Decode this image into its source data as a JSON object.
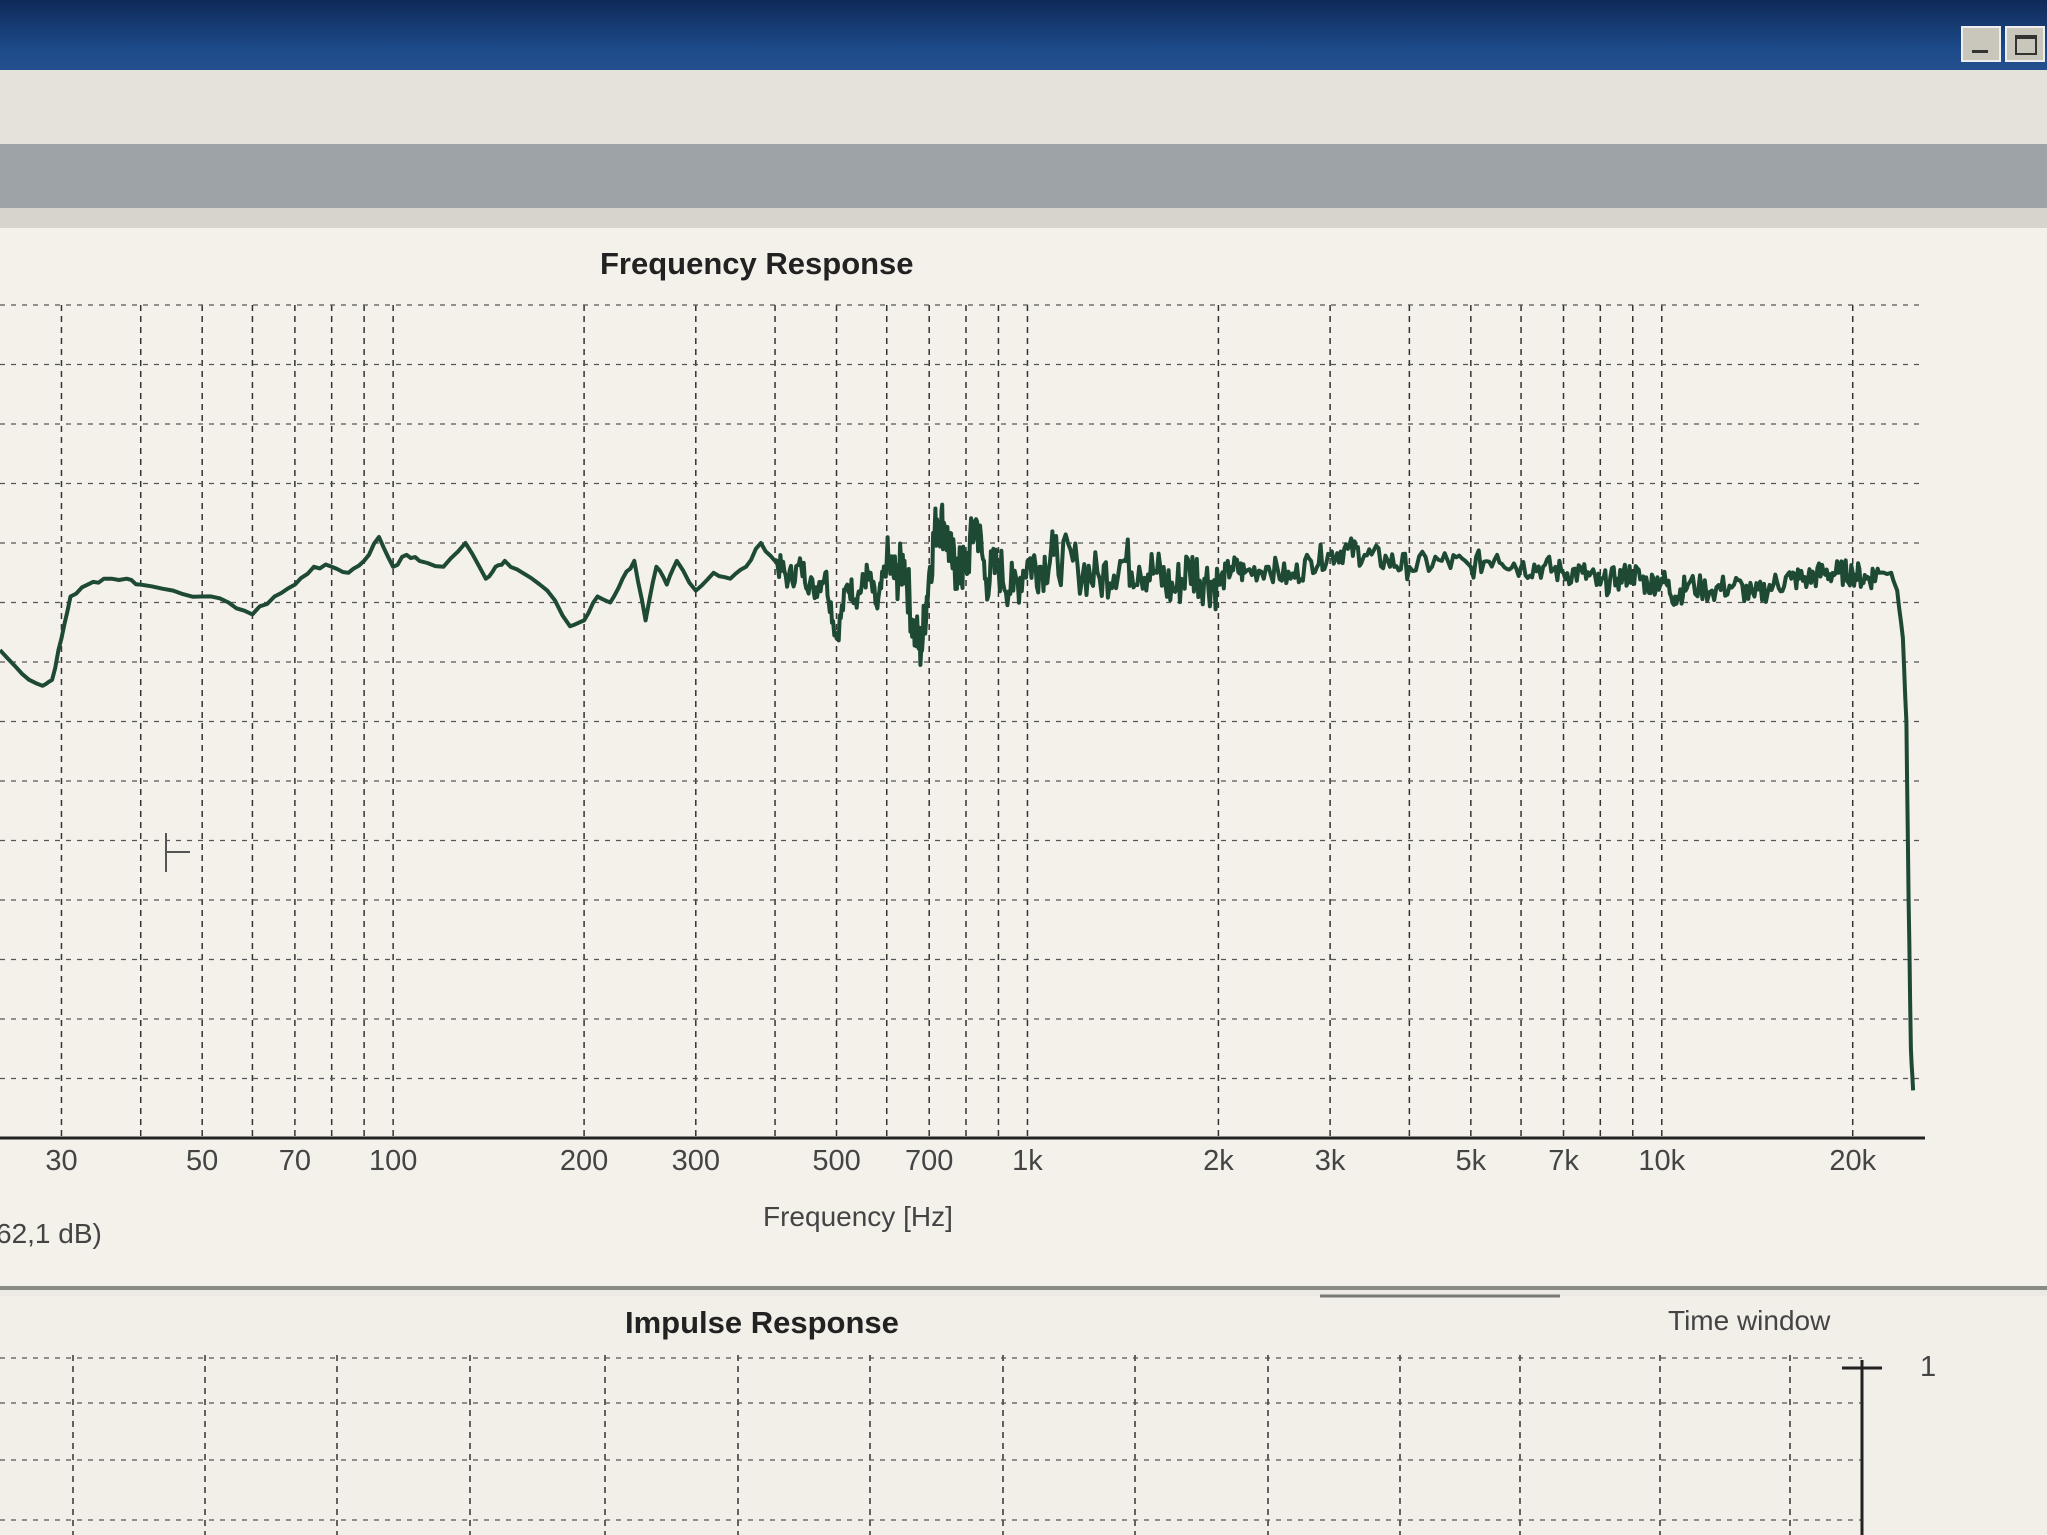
{
  "window": {
    "colors": {
      "title_bar": "#1d4a8a",
      "background": "#f3f1ea",
      "trace": "#1e4a34"
    }
  },
  "frequency_panel": {
    "title": "Frequency Response",
    "xlabel": "Frequency [Hz]",
    "level_readout": "62,1 dB)"
  },
  "impulse_panel": {
    "title": "Impulse Response",
    "time_window_label": "Time window",
    "marker_label": "1"
  },
  "chart_data": [
    {
      "type": "line",
      "title": "Frequency Response",
      "xlabel": "Frequency [Hz]",
      "ylabel": "",
      "xscale": "log",
      "xlim": [
        24,
        26000
      ],
      "ylim": [
        -14,
        0
      ],
      "grid": true,
      "x_tick_labels": [
        {
          "value": 30,
          "label": "30"
        },
        {
          "value": 50,
          "label": "50"
        },
        {
          "value": 70,
          "label": "70"
        },
        {
          "value": 100,
          "label": "100"
        },
        {
          "value": 200,
          "label": "200"
        },
        {
          "value": 300,
          "label": "300"
        },
        {
          "value": 500,
          "label": "500"
        },
        {
          "value": 700,
          "label": "700"
        },
        {
          "value": 1000,
          "label": "1k"
        },
        {
          "value": 2000,
          "label": "2k"
        },
        {
          "value": 3000,
          "label": "3k"
        },
        {
          "value": 5000,
          "label": "5k"
        },
        {
          "value": 7000,
          "label": "7k"
        },
        {
          "value": 10000,
          "label": "10k"
        },
        {
          "value": 20000,
          "label": "20k"
        }
      ],
      "series": [
        {
          "x": [
            24,
            26,
            28,
            29,
            30,
            31,
            33,
            35,
            38,
            40,
            45,
            50,
            55,
            60,
            65,
            70,
            75,
            80,
            85,
            90,
            95,
            100,
            105,
            110,
            120,
            130,
            140,
            145,
            150,
            160,
            175,
            190,
            200,
            210,
            220,
            230,
            240,
            250,
            260,
            270,
            280,
            300,
            320,
            340,
            360,
            380,
            400,
            420,
            440,
            460,
            480,
            500,
            520,
            540,
            560,
            580,
            600,
            620,
            640,
            660,
            680,
            700,
            720,
            740,
            760,
            780,
            800,
            830,
            860,
            900,
            950,
            1000,
            1050,
            1100,
            1200,
            1300,
            1400,
            1500,
            1600,
            1700,
            1800,
            1900,
            2000,
            2100,
            2200,
            2400,
            2600,
            2800,
            3000,
            3200,
            3400,
            3700,
            4000,
            4500,
            5000,
            5500,
            6000,
            6500,
            7000,
            7500,
            8000,
            8500,
            9000,
            9500,
            10000,
            10500,
            11000,
            12000,
            13000,
            14000,
            15000,
            16000,
            17000,
            18000,
            19000,
            20000,
            21000,
            22000,
            23000,
            23500,
            24000,
            24300,
            24500,
            24700,
            24900
          ],
          "y": [
            -5.8,
            -6.2,
            -6.4,
            -6.3,
            -5.6,
            -4.9,
            -4.7,
            -4.6,
            -4.6,
            -4.7,
            -4.8,
            -4.9,
            -5.0,
            -5.2,
            -4.9,
            -4.7,
            -4.4,
            -4.4,
            -4.5,
            -4.3,
            -3.9,
            -4.4,
            -4.2,
            -4.3,
            -4.4,
            -4.0,
            -4.6,
            -4.4,
            -4.3,
            -4.5,
            -4.8,
            -5.4,
            -5.3,
            -4.9,
            -5.0,
            -4.6,
            -4.3,
            -5.3,
            -4.4,
            -4.7,
            -4.3,
            -4.8,
            -4.5,
            -4.6,
            -4.4,
            -4.0,
            -4.3,
            -4.6,
            -4.4,
            -4.8,
            -4.5,
            -5.6,
            -4.7,
            -4.9,
            -4.5,
            -5.1,
            -4.3,
            -4.6,
            -4.3,
            -5.4,
            -5.8,
            -4.5,
            -3.6,
            -3.7,
            -4.3,
            -4.5,
            -4.4,
            -3.6,
            -4.6,
            -4.4,
            -4.8,
            -4.3,
            -4.4,
            -4.2,
            -4.4,
            -4.6,
            -4.3,
            -4.4,
            -4.5,
            -4.8,
            -4.4,
            -4.6,
            -4.7,
            -4.4,
            -4.5,
            -4.4,
            -4.6,
            -4.3,
            -4.2,
            -4.1,
            -4.2,
            -4.3,
            -4.4,
            -4.3,
            -4.4,
            -4.2,
            -4.4,
            -4.4,
            -4.5,
            -4.5,
            -4.7,
            -4.6,
            -4.5,
            -4.7,
            -4.6,
            -4.9,
            -4.7,
            -4.8,
            -4.7,
            -4.9,
            -4.7,
            -4.6,
            -4.6,
            -4.5,
            -4.5,
            -4.5,
            -4.6,
            -4.5,
            -4.5,
            -4.8,
            -5.6,
            -7.0,
            -10.0,
            -12.5,
            -13.2
          ]
        }
      ]
    },
    {
      "type": "line",
      "title": "Impulse Response",
      "xlabel": "",
      "ylabel": "",
      "grid": true,
      "annotations": [
        "Time window",
        "1"
      ]
    }
  ]
}
